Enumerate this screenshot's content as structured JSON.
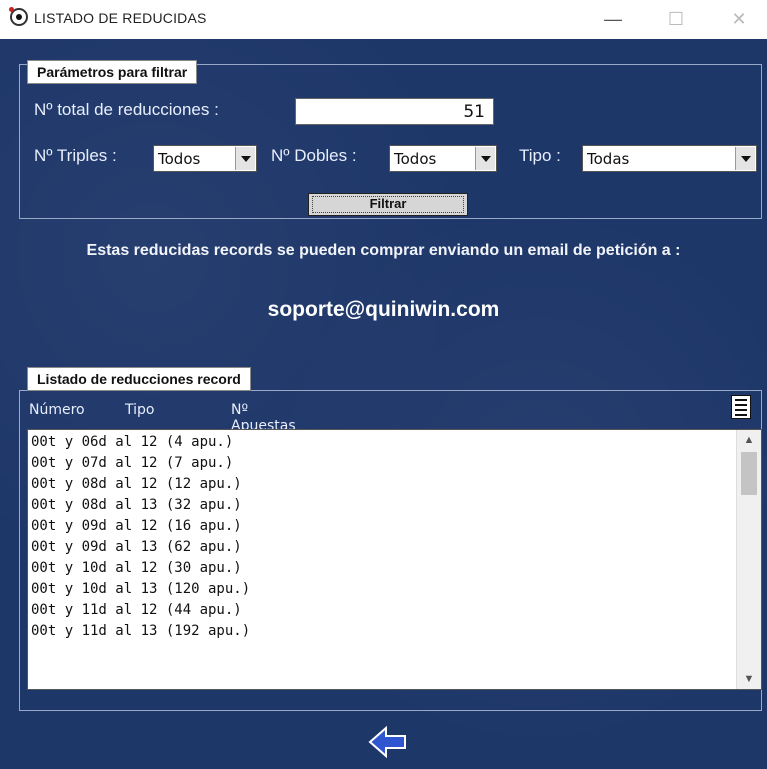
{
  "window": {
    "title": "LISTADO DE REDUCIDAS",
    "min_label": "—",
    "max_label": "☐",
    "close_label": "✕"
  },
  "filter": {
    "group_title": "Parámetros para filtrar",
    "total_label": "Nº total de reducciones :",
    "total_value": "51",
    "triples_label": "Nº Triples :",
    "triples_value": "Todos",
    "dobles_label": "Nº Dobles :",
    "dobles_value": "Todos",
    "tipo_label": "Tipo :",
    "tipo_value": "Todas",
    "button_label": "Filtrar"
  },
  "info": {
    "text": "Estas reducidas records se pueden comprar enviando un email de petición a :",
    "email": "soporte@quiniwin.com"
  },
  "list": {
    "group_title": "Listado de reducciones record",
    "headers": {
      "numero": "Número",
      "tipo": "Tipo",
      "apuestas": "Nº Apuestas"
    },
    "rows": [
      "00t y 06d al 12 (4 apu.)",
      "00t y 07d al 12 (7 apu.)",
      "00t y 08d al 12 (12 apu.)",
      "00t y 08d al 13 (32 apu.)",
      "00t y 09d al 12 (16 apu.)",
      "00t y 09d al 13 (62 apu.)",
      "00t y 10d al 12 (30 apu.)",
      "00t y 10d al 13 (120 apu.)",
      "00t y 11d al 12 (44 apu.)",
      "00t y 11d al 13 (192 apu.)"
    ]
  },
  "icons": {
    "app": "soccer-ball-icon",
    "export": "document-icon",
    "back": "back-arrow-icon"
  },
  "colors": {
    "background": "#1e3769",
    "back_arrow": "#2f55d0"
  }
}
